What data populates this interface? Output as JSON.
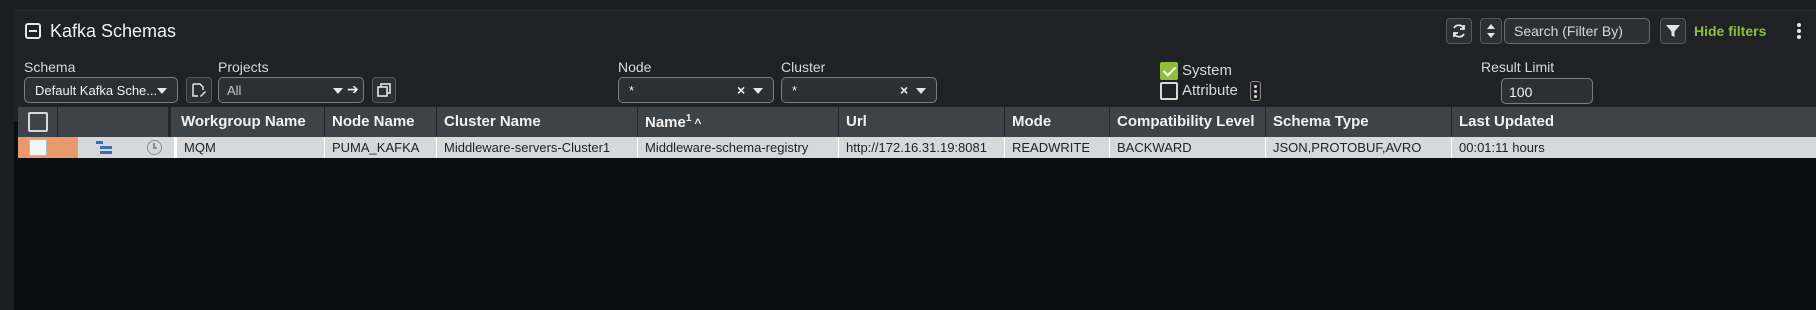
{
  "header": {
    "title": "Kafka Schemas",
    "refresh_icon": "refresh-icon",
    "sort_icon": "sort-updown-icon",
    "search_placeholder": "Search (Filter By)",
    "filter_icon": "funnel-icon",
    "hide_filters_label": "Hide filters",
    "accent_color": "#8fbf3a"
  },
  "filters": {
    "schema": {
      "label": "Schema",
      "value": "Default Kafka Sche..."
    },
    "projects": {
      "label": "Projects",
      "value": "All"
    },
    "node": {
      "label": "Node",
      "value": "*"
    },
    "cluster": {
      "label": "Cluster",
      "value": "*"
    },
    "system": {
      "label": "System",
      "checked": true
    },
    "attribute": {
      "label": "Attribute",
      "checked": false
    },
    "result_limit": {
      "label": "Result Limit",
      "value": "100"
    }
  },
  "table": {
    "columns": [
      "Workgroup Name",
      "Node Name",
      "Cluster Name",
      "Name",
      "Url",
      "Mode",
      "Compatibility Level",
      "Schema Type",
      "Last Updated"
    ],
    "sort_indicator": "1",
    "rows": [
      {
        "workgroup": "MQM",
        "node": "PUMA_KAFKA",
        "cluster": "Middleware-servers-Cluster1",
        "name": "Middleware-schema-registry",
        "url": "http://172.16.31.19:8081",
        "mode": "READWRITE",
        "compatibility": "BACKWARD",
        "schema_type": "JSON,PROTOBUF,AVRO",
        "last_updated": "00:01:11 hours"
      }
    ]
  }
}
